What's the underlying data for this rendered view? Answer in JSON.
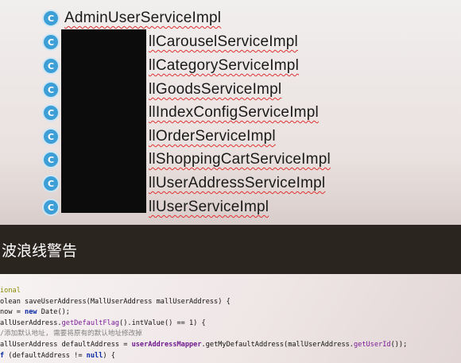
{
  "tree": {
    "items": [
      {
        "icon": "C",
        "label": "AdminUserServiceImpl"
      },
      {
        "icon": "C",
        "label": "llCarouselServiceImpl"
      },
      {
        "icon": "C",
        "label": "llCategoryServiceImpl"
      },
      {
        "icon": "C",
        "label": "llGoodsServiceImpl"
      },
      {
        "icon": "C",
        "label": "llIndexConfigServiceImpl"
      },
      {
        "icon": "C",
        "label": "llOrderServiceImpl"
      },
      {
        "icon": "C",
        "label": "llShoppingCartServiceImpl"
      },
      {
        "icon": "C",
        "label": "llUserAddressServiceImpl"
      },
      {
        "icon": "C",
        "label": "llUserServiceImpl"
      }
    ]
  },
  "banner": {
    "text": "波浪线警告"
  },
  "code": {
    "line1": "ional",
    "line2a": "olean saveUserAddress(MallUserAddress mallUserAddress) {",
    "line3a": "now = ",
    "line3b": "new",
    "line3c": " Date();",
    "line4a": "allUserAddress.",
    "line4b": "getDefaultFlag",
    "line4c": "().intValue() == 1) {",
    "line5": "/添加默认地址, 需要将原有的默认地址修改掉",
    "line6a": "allUserAddress defaultAddress = ",
    "line6b": "userAddressMapper",
    "line6c": ".getMyDefaultAddress(mallUserAddress.",
    "line6d": "getUserId",
    "line6e": "());",
    "line7a": "f",
    "line7b": " (defaultAddress != ",
    "line7c": "null",
    "line7d": ") {"
  },
  "colors": {
    "class_icon": "#3d9fd6",
    "banner_bg": "#2b2520",
    "squiggle": "#e03131"
  }
}
